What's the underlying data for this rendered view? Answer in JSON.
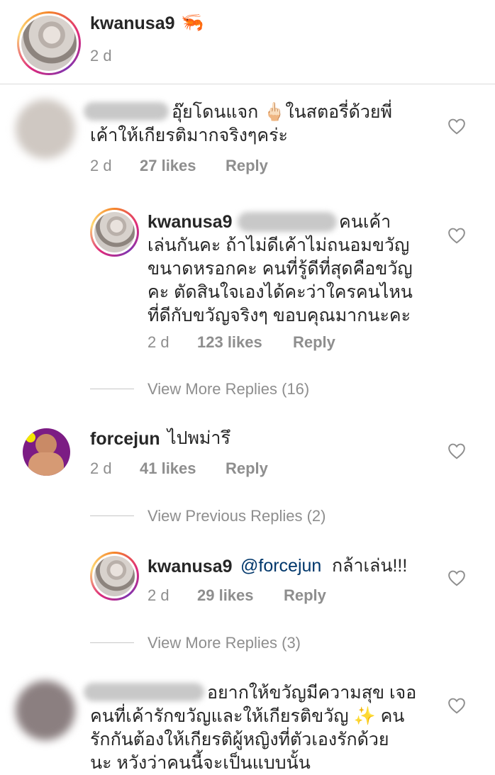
{
  "post": {
    "username": "kwanusa9",
    "emoji": "🦐",
    "time": "2 d"
  },
  "comments": [
    {
      "text_line1": "อุ๊ยโดนแจก 🖕🏻ในสตอรี่ด้วยพี่",
      "text_line2": "เค้าให้เกียรติมากจริงๆคร่ะ",
      "time": "2 d",
      "likes": "27 likes",
      "reply": "Reply"
    },
    {
      "username": "kwanusa9",
      "lines": [
        "คนเค้า",
        "เล่นกันคะ ถ้าไม่ดีเค้าไม่ถนอมขวัญ",
        "ขนาดหรอกคะ คนที่รู้ดีที่สุดคือขวัญ",
        "คะ ตัดสินใจเองได้คะว่าใครคนไหน",
        "ที่ดีกับขวัญจริงๆ ขอบคุณมากนะคะ"
      ],
      "time": "2 d",
      "likes": "123 likes",
      "reply": "Reply"
    },
    {
      "view_more": "View More Replies (16)"
    },
    {
      "username": "forcejun",
      "text": "ไปพม่ารึ",
      "time": "2 d",
      "likes": "41 likes",
      "reply": "Reply"
    },
    {
      "view_previous": "View Previous Replies (2)"
    },
    {
      "username": "kwanusa9",
      "mention": "@forcejun",
      "text": "กล้าเล่น!!!",
      "time": "2 d",
      "likes": "29 likes",
      "reply": "Reply"
    },
    {
      "view_more": "View More Replies (3)"
    },
    {
      "lines": [
        "อยากให้ขวัญมีความสุข เจอ",
        "คนที่เค้ารักขวัญและให้เกียรติขวัญ ✨ คน",
        "รักกันต้องให้เกียรติผู้หญิงที่ตัวเองรักด้วย",
        "นะ หวังว่าคนนี้จะเป็นแบบนั้น"
      ]
    }
  ],
  "colors": {
    "username": "#262626",
    "meta": "#8e8e8e",
    "mention": "#00376b",
    "heart": "#8e8e8e"
  }
}
